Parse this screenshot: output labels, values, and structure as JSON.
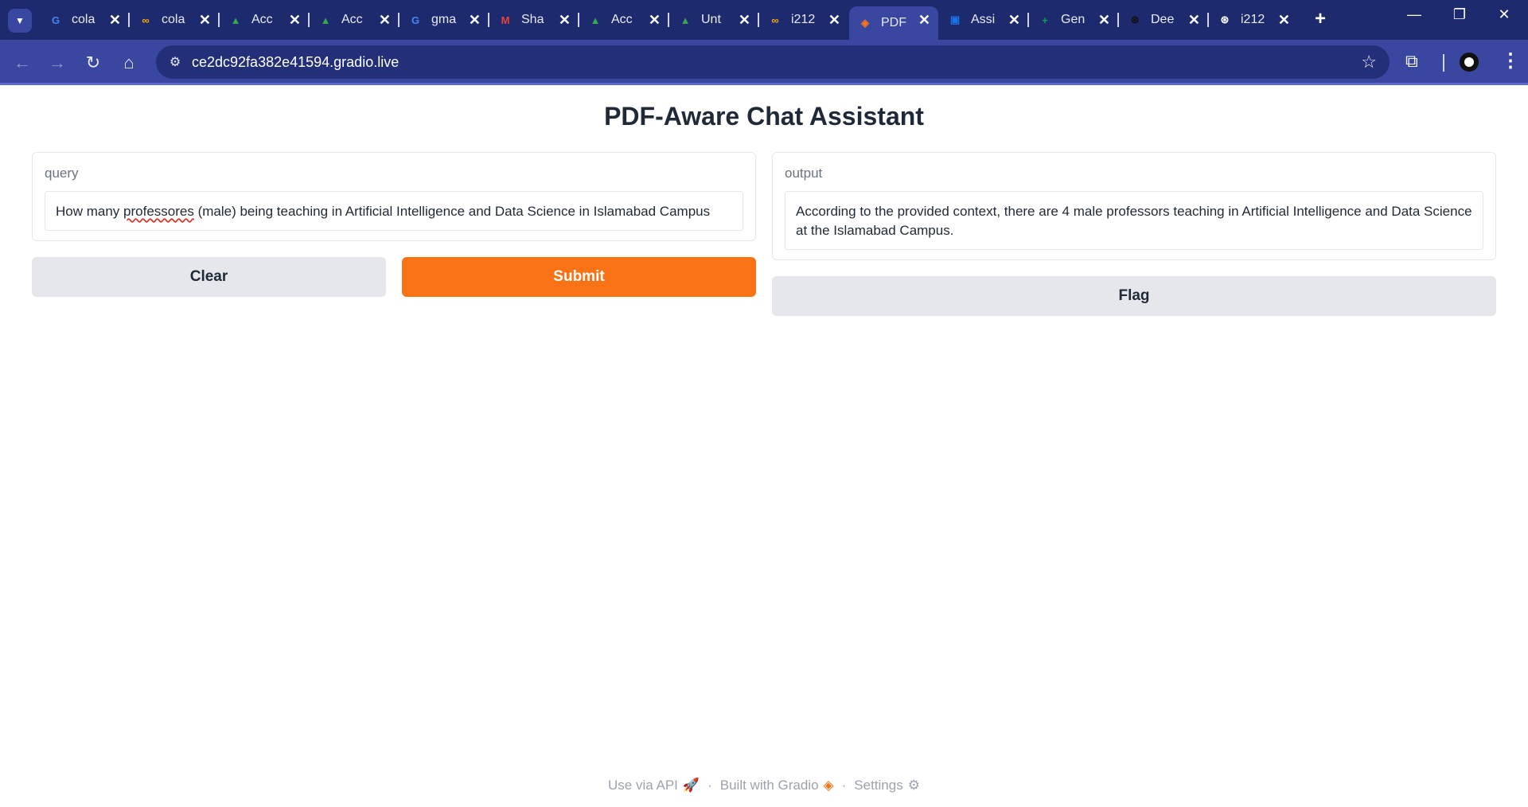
{
  "browser": {
    "tabs": [
      {
        "title": "cola",
        "icon": "google-icon",
        "color": "#4285f4"
      },
      {
        "title": "cola",
        "icon": "colab-icon",
        "color": "#f9ab00"
      },
      {
        "title": "Acc",
        "icon": "google-drive-icon",
        "color": "#34a853"
      },
      {
        "title": "Acc",
        "icon": "google-drive-icon",
        "color": "#34a853"
      },
      {
        "title": "gma",
        "icon": "google-icon",
        "color": "#4285f4"
      },
      {
        "title": "Sha",
        "icon": "gmail-icon",
        "color": "#ea4335"
      },
      {
        "title": "Acc",
        "icon": "google-drive-icon",
        "color": "#34a853"
      },
      {
        "title": "Unt",
        "icon": "google-drive-icon",
        "color": "#34a853"
      },
      {
        "title": "i212",
        "icon": "colab-icon",
        "color": "#f9ab00"
      },
      {
        "title": "PDF",
        "icon": "gradio-icon",
        "color": "#f97316",
        "active": true
      },
      {
        "title": "Assi",
        "icon": "contacts-icon",
        "color": "#1a73e8"
      },
      {
        "title": "Gen",
        "icon": "google-sheets-icon",
        "color": "#0f9d58"
      },
      {
        "title": "Dee",
        "icon": "openai-icon",
        "color": "#111111"
      },
      {
        "title": "i212",
        "icon": "openai-icon",
        "color": "#ffffff"
      }
    ],
    "url": "ce2dc92fa382e41594.gradio.live"
  },
  "app": {
    "title": "PDF-Aware Chat Assistant",
    "query": {
      "label": "query",
      "value_before": "How many ",
      "value_misspelled": "professores",
      "value_after": " (male) being teaching in Artificial Intelligence and Data Science in Islamabad Campus"
    },
    "output": {
      "label": "output",
      "value": "According to the provided context, there are 4 male professors teaching in Artificial Intelligence and Data Science at the Islamabad Campus."
    },
    "buttons": {
      "clear": "Clear",
      "submit": "Submit",
      "flag": "Flag"
    },
    "footer": {
      "api": "Use via API",
      "built": "Built with Gradio",
      "settings": "Settings",
      "separator": "·"
    }
  }
}
